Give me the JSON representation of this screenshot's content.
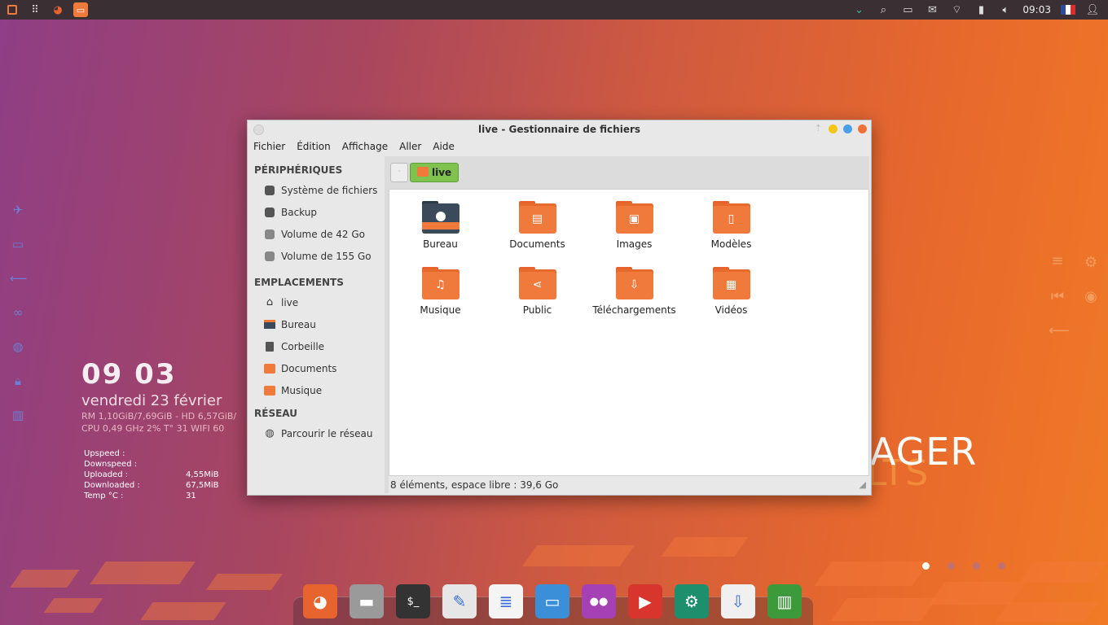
{
  "top_panel": {
    "clock": "09:03",
    "left_icons": [
      "menu-icon",
      "apps-grid-icon",
      "firefox-icon",
      "file-manager-icon"
    ],
    "right_icons": [
      "chevron-down-icon",
      "search-icon",
      "display-icon",
      "mail-icon",
      "wifi-icon",
      "clipboard-icon",
      "volume-icon"
    ]
  },
  "clock_widget": {
    "time_hours": "09",
    "time_minutes": "03",
    "date": "vendredi 23 février",
    "line1": "RM 1,10GiB/7,69GiB - HD 6,57GiB/",
    "line2": "CPU 0,49 GHz 2% T° 31   WIFI 60"
  },
  "net_stats": [
    {
      "k": "Upspeed :",
      "v": ""
    },
    {
      "k": "Downspeed :",
      "v": ""
    },
    {
      "k": "Uploaded :",
      "v": "4,55MiB"
    },
    {
      "k": "Downloaded :",
      "v": "67,5MiB"
    },
    {
      "k": "Temp °C :",
      "v": "31"
    }
  ],
  "brand": {
    "line1": "AGER",
    "line2": "LTS"
  },
  "window": {
    "title": "live - Gestionnaire de fichiers",
    "menu": [
      "Fichier",
      "Édition",
      "Affichage",
      "Aller",
      "Aide"
    ],
    "sidebar": {
      "sections": [
        {
          "title": "PÉRIPHÉRIQUES",
          "items": [
            {
              "label": "Système de fichiers",
              "icon": "drive-icon"
            },
            {
              "label": "Backup",
              "icon": "drive-icon"
            },
            {
              "label": "Volume de 42 Go",
              "icon": "drive-icon"
            },
            {
              "label": "Volume de 155 Go",
              "icon": "drive-icon"
            }
          ]
        },
        {
          "title": "EMPLACEMENTS",
          "items": [
            {
              "label": "live",
              "icon": "home-icon"
            },
            {
              "label": "Bureau",
              "icon": "desktop-icon"
            },
            {
              "label": "Corbeille",
              "icon": "trash-icon"
            },
            {
              "label": "Documents",
              "icon": "folder-icon"
            },
            {
              "label": "Musique",
              "icon": "folder-icon"
            }
          ]
        },
        {
          "title": "RÉSEAU",
          "items": [
            {
              "label": "Parcourir le réseau",
              "icon": "network-icon"
            }
          ]
        }
      ]
    },
    "path_button": "live",
    "files": [
      {
        "label": "Bureau",
        "icon": "desktop-folder-icon",
        "glyph": ""
      },
      {
        "label": "Documents",
        "icon": "documents-folder-icon",
        "glyph": "▤"
      },
      {
        "label": "Images",
        "icon": "images-folder-icon",
        "glyph": "▣"
      },
      {
        "label": "Modèles",
        "icon": "templates-folder-icon",
        "glyph": "▯"
      },
      {
        "label": "Musique",
        "icon": "music-folder-icon",
        "glyph": "♫"
      },
      {
        "label": "Public",
        "icon": "public-folder-icon",
        "glyph": "⋖"
      },
      {
        "label": "Téléchargements",
        "icon": "downloads-folder-icon",
        "glyph": "⇩"
      },
      {
        "label": "Vidéos",
        "icon": "videos-folder-icon",
        "glyph": "▦"
      }
    ],
    "status": "8 éléments, espace libre : 39,6 Go"
  },
  "dock": {
    "apps": [
      {
        "name": "firefox-icon",
        "color": "#e8642e",
        "glyph": "◕"
      },
      {
        "name": "file-manager-icon",
        "color": "#9a9a9a",
        "glyph": "▬"
      },
      {
        "name": "terminal-icon",
        "color": "#333333",
        "glyph": "$_"
      },
      {
        "name": "text-editor-icon",
        "color": "#e6e6e6",
        "glyph": "✎"
      },
      {
        "name": "writer-icon",
        "color": "#f4f4f4",
        "glyph": "≣"
      },
      {
        "name": "screenshot-icon",
        "color": "#3a8fd8",
        "glyph": "▭"
      },
      {
        "name": "media-player-icon",
        "color": "#a641b5",
        "glyph": "●●"
      },
      {
        "name": "youtube-icon",
        "color": "#d8362c",
        "glyph": "▶"
      },
      {
        "name": "settings-icon",
        "color": "#1e8f6c",
        "glyph": "⚙"
      },
      {
        "name": "software-install-icon",
        "color": "#f0f0f0",
        "glyph": "⇩"
      },
      {
        "name": "trash-icon",
        "color": "#3c9a3a",
        "glyph": "▥"
      }
    ]
  }
}
